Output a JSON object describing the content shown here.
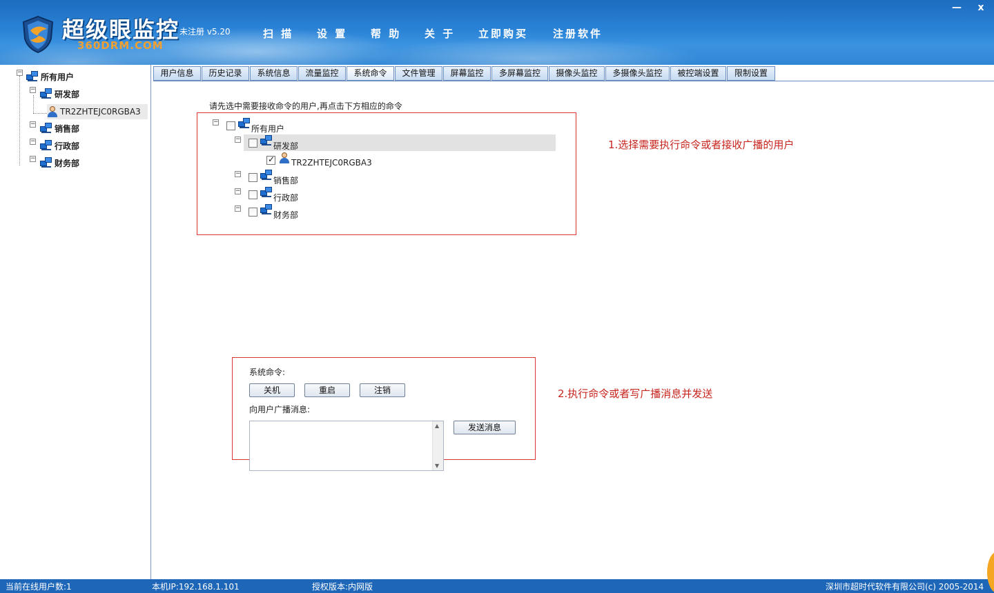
{
  "header": {
    "app_title": "超级眼监控",
    "app_sub": "360DRM.COM",
    "reg_status": "未注册 v5.20",
    "menu": [
      "扫 描",
      "设 置",
      "帮 助",
      "关 于",
      "立即购买",
      "注册软件"
    ],
    "minimize": "—",
    "close": "x"
  },
  "tree": {
    "root": "所有用户",
    "dept1": "研发部",
    "user1": "TR2ZHTEJC0RGBA3",
    "dept2": "销售部",
    "dept3": "行政部",
    "dept4": "财务部"
  },
  "tabs": [
    "用户信息",
    "历史记录",
    "系统信息",
    "流量监控",
    "系统命令",
    "文件管理",
    "屏幕监控",
    "多屏幕监控",
    "摄像头监控",
    "多摄像头监控",
    "被控端设置",
    "限制设置"
  ],
  "main": {
    "instruction": "请先选中需要接收命令的用户,再点击下方相应的命令",
    "annot1": "1.选择需要执行命令或者接收广播的用户",
    "annot2": "2.执行命令或者写广播消息并发送",
    "sys_cmd_label": "系统命令:",
    "shutdown": "关机",
    "restart": "重启",
    "logoff": "注销",
    "broadcast_label": "向用户广播消息:",
    "send": "发送消息",
    "message": ""
  },
  "status": {
    "online": "当前在线用户数:1",
    "ip": "本机IP:192.168.1.101",
    "license": "授权版本:内网版",
    "copyright": "深圳市超时代软件有限公司(c) 2005-2014"
  },
  "colors": {
    "header": "#2a82d6",
    "status": "#1e66b8",
    "annotation": "#c8241e"
  }
}
